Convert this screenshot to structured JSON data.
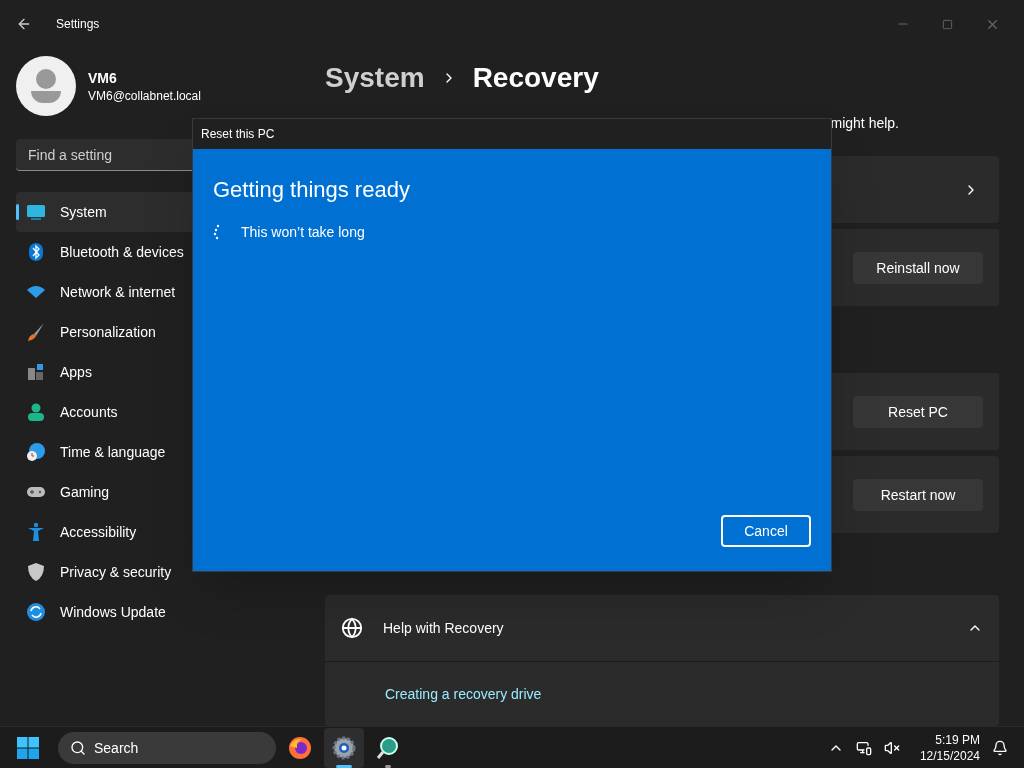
{
  "window": {
    "title": "Settings"
  },
  "user": {
    "name": "VM6",
    "email": "VM6@collabnet.local"
  },
  "search": {
    "placeholder": "Find a setting"
  },
  "nav": [
    {
      "label": "System",
      "selected": true
    },
    {
      "label": "Bluetooth & devices",
      "selected": false
    },
    {
      "label": "Network & internet",
      "selected": false
    },
    {
      "label": "Personalization",
      "selected": false
    },
    {
      "label": "Apps",
      "selected": false
    },
    {
      "label": "Accounts",
      "selected": false
    },
    {
      "label": "Time & language",
      "selected": false
    },
    {
      "label": "Gaming",
      "selected": false
    },
    {
      "label": "Accessibility",
      "selected": false
    },
    {
      "label": "Privacy & security",
      "selected": false
    },
    {
      "label": "Windows Update",
      "selected": false
    }
  ],
  "breadcrumb": {
    "parent": "System",
    "current": "Recovery"
  },
  "description": "might help.",
  "cards": [
    {
      "kind": "link"
    },
    {
      "kind": "button",
      "button": "Reinstall now"
    },
    {
      "kind": "gap"
    },
    {
      "kind": "button",
      "button": "Reset PC"
    },
    {
      "kind": "button",
      "button": "Restart now"
    }
  ],
  "help": {
    "title": "Help with Recovery",
    "expanded": true,
    "links": [
      "Creating a recovery drive"
    ]
  },
  "dialog": {
    "title": "Reset this PC",
    "heading": "Getting things ready",
    "status": "This won’t take long",
    "button": "Cancel"
  },
  "taskbar": {
    "search": "Search",
    "apps": [
      {
        "kind": "firefox",
        "selected": false,
        "running": false
      },
      {
        "kind": "settings",
        "selected": true,
        "running": true
      },
      {
        "kind": "search-app",
        "selected": false,
        "running": true
      }
    ],
    "time": "5:19 PM",
    "date": "12/15/2024"
  }
}
